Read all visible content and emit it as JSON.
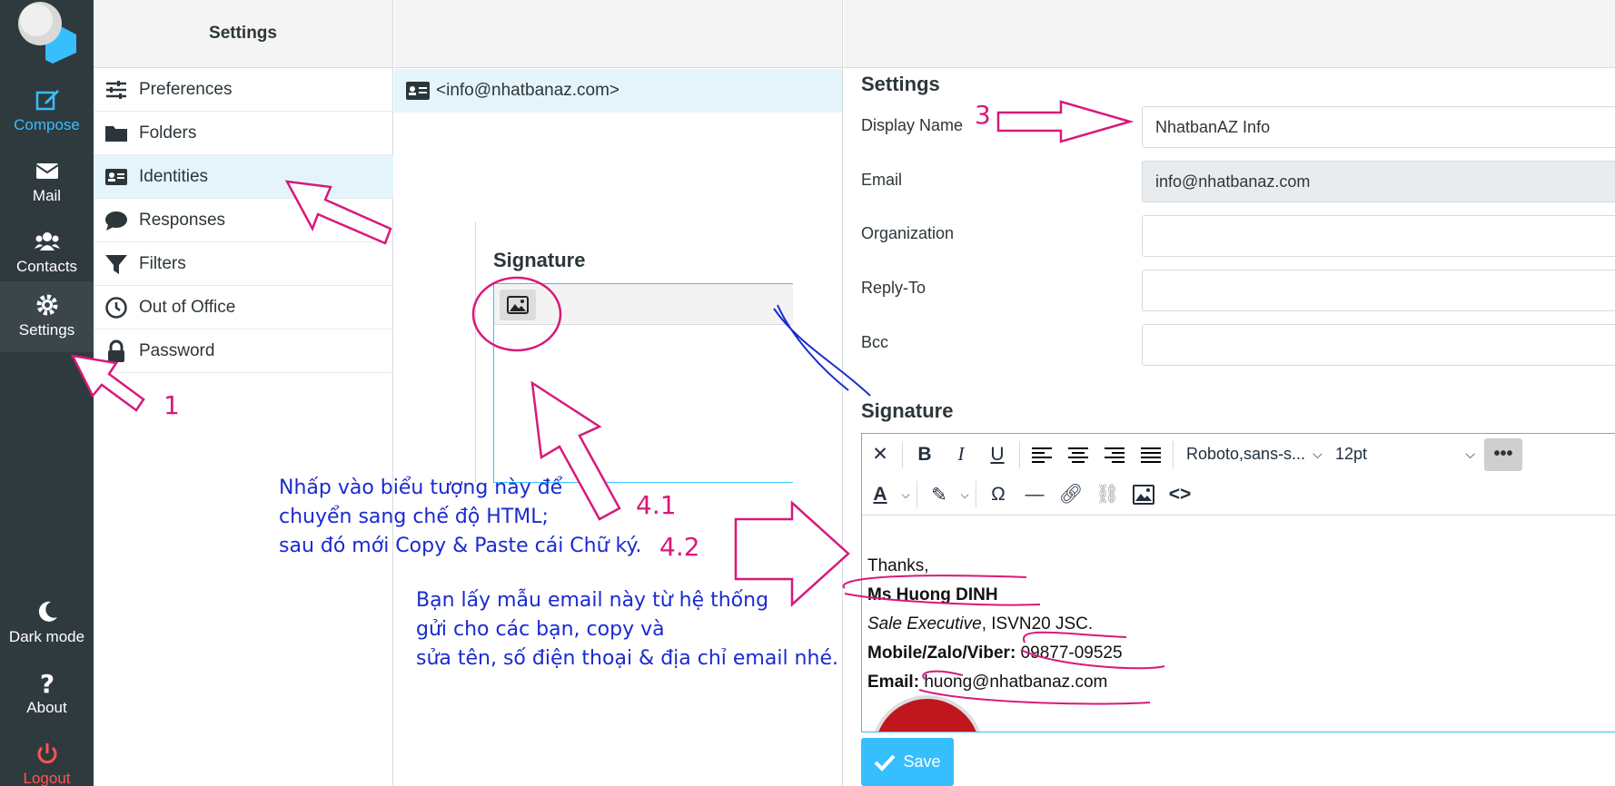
{
  "rail": {
    "items": [
      {
        "label": "Compose",
        "icon": "compose-icon"
      },
      {
        "label": "Mail",
        "icon": "mail-icon"
      },
      {
        "label": "Contacts",
        "icon": "contacts-icon"
      },
      {
        "label": "Settings",
        "icon": "gear-icon"
      },
      {
        "label": "Dark mode",
        "icon": "moon-icon"
      },
      {
        "label": "About",
        "icon": "question-icon"
      },
      {
        "label": "Logout",
        "icon": "power-icon"
      }
    ]
  },
  "settings_nav": {
    "title": "Settings",
    "items": [
      {
        "label": "Preferences",
        "icon": "sliders-icon"
      },
      {
        "label": "Folders",
        "icon": "folder-icon"
      },
      {
        "label": "Identities",
        "icon": "id-card-icon"
      },
      {
        "label": "Responses",
        "icon": "comment-icon"
      },
      {
        "label": "Filters",
        "icon": "filter-icon"
      },
      {
        "label": "Out of Office",
        "icon": "clock-icon"
      },
      {
        "label": "Password",
        "icon": "lock-icon"
      }
    ]
  },
  "identities": {
    "rows": [
      {
        "label": "<info@nhatbanaz.com>"
      }
    ]
  },
  "inset": {
    "title": "Signature"
  },
  "form": {
    "section_title": "Settings",
    "display_name_label": "Display Name",
    "display_name_value": "NhatbanAZ Info",
    "email_label": "Email",
    "email_value": "info@nhatbanaz.com",
    "organization_label": "Organization",
    "replyto_label": "Reply-To",
    "bcc_label": "Bcc",
    "signature_title": "Signature",
    "save_label": "Save"
  },
  "editor": {
    "font_family": "Roboto,sans-s...",
    "font_size": "12pt",
    "more": "•••",
    "body": {
      "line1": "Thanks,",
      "name": "Ms Huong DINH",
      "title_italic": "Sale Executive",
      "title_rest": ", ISVN20 JSC.",
      "phone_label": "Mobile/Zalo/Viber:",
      "phone_value": "09877-09525",
      "email_label": "Email:",
      "email_value": "huong@nhatbanaz.com"
    }
  },
  "annotations": {
    "num1": "1",
    "num3": "3",
    "num41": "4.1",
    "num42": "4.2",
    "note1_l1": "Nhấp vào biểu tượng này để",
    "note1_l2": "chuyển sang chế độ HTML;",
    "note1_l3": "sau đó mới Copy & Paste cái Chữ ký.",
    "note2_l1": "Bạn lấy mẫu email này từ hệ thống",
    "note2_l2": "gửi cho các bạn, copy và",
    "note2_l3": "sửa tên, số điện thoại & địa chỉ email nhé."
  },
  "colors": {
    "accent": "#37beff",
    "rail": "#2f3a3f",
    "annotation_pink": "#d8197a",
    "annotation_blue": "#1a2bcf"
  }
}
